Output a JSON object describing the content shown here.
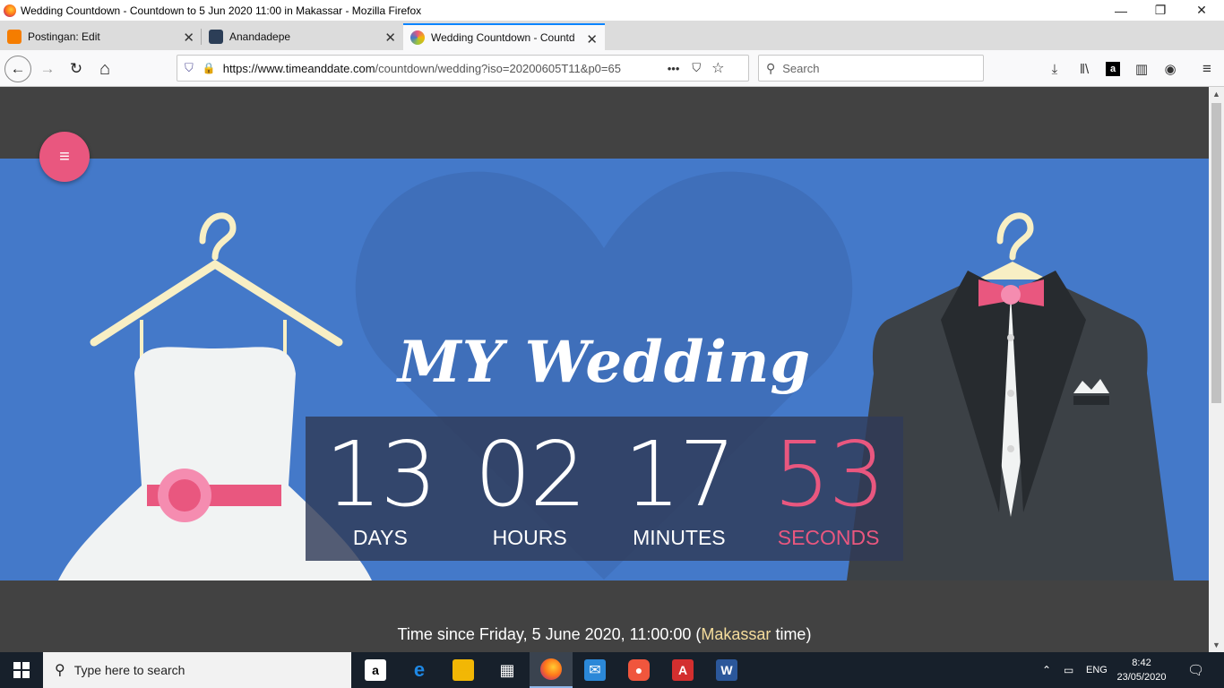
{
  "window": {
    "title": "Wedding Countdown - Countdown to 5 Jun 2020 11:00 in Makassar - Mozilla Firefox",
    "minimize": "—",
    "restore": "❐",
    "close": "✕"
  },
  "tabs": [
    {
      "label": "Postingan: Edit",
      "close": "✕",
      "icon": "blogger-icon",
      "color": "#f57d00"
    },
    {
      "label": "Anandadepe",
      "close": "✕",
      "icon": "site-icon",
      "color": "#2c3e57"
    },
    {
      "label": "Wedding Countdown - Countd",
      "close": "✕",
      "icon": "timeanddate-icon",
      "color": "#9ec63a"
    }
  ],
  "new_tab": "+",
  "nav": {
    "back": "←",
    "forward": "→",
    "reload": "↻",
    "home": "⌂",
    "url_host": "https://www.timeanddate.com",
    "url_path": "/countdown/wedding?iso=20200605T11&p0=65",
    "page_actions": "•••",
    "search_placeholder": "Search"
  },
  "page": {
    "menu_icon": "≡",
    "title": "MY Wedding",
    "countdown": [
      {
        "value": "13",
        "label": "DAYS"
      },
      {
        "value": "02",
        "label": "HOURS"
      },
      {
        "value": "17",
        "label": "MINUTES"
      },
      {
        "value": "53",
        "label": "SECONDS"
      }
    ],
    "footer_prefix": "Time since Friday, 5 June 2020, 11:00:00 (",
    "footer_city": "Makassar",
    "footer_suffix": " time)"
  },
  "taskbar": {
    "search_placeholder": "Type here to search",
    "apps": [
      {
        "name": "amazon-app",
        "glyph": "a",
        "color": "#ffffff"
      },
      {
        "name": "edge-app",
        "glyph": "e",
        "color": "#1e88e5"
      },
      {
        "name": "file-explorer-app",
        "glyph": "▬",
        "color": "#f2b705"
      },
      {
        "name": "store-app",
        "glyph": "▦",
        "color": "#ffffff"
      },
      {
        "name": "firefox-app",
        "glyph": "●",
        "color": "#ff7a1a"
      },
      {
        "name": "mail-app",
        "glyph": "✉",
        "color": "#2b88d8"
      },
      {
        "name": "recorder-app",
        "glyph": "●",
        "color": "#f0563d"
      },
      {
        "name": "acrobat-app",
        "glyph": "A",
        "color": "#d32f2f"
      },
      {
        "name": "word-app",
        "glyph": "W",
        "color": "#2b579a"
      }
    ],
    "lang": "ENG",
    "time": "8:42",
    "date": "23/05/2020"
  }
}
